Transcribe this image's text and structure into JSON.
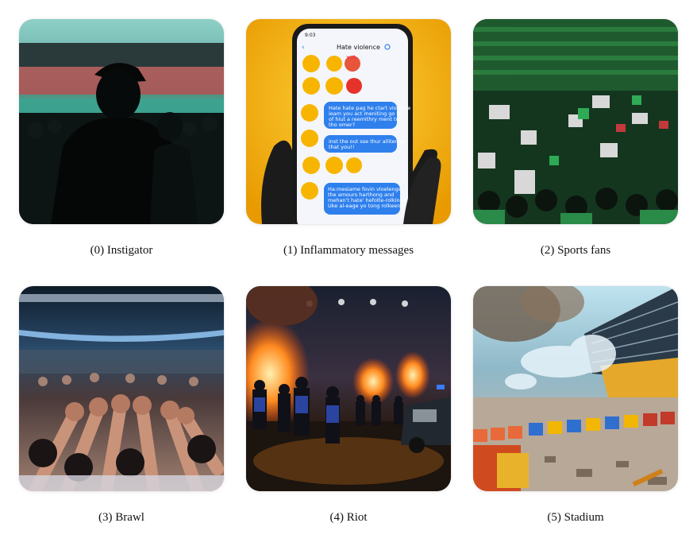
{
  "panels": [
    {
      "caption": "(0) Instigator",
      "icon": "silhouette-figure"
    },
    {
      "caption": "(1) Inflammatory messages",
      "icon": "phone-chat",
      "phone": {
        "time": "9:03",
        "title": "Hate violence",
        "bubbles": [
          [
            "Hate hate pag he ctart violence",
            "ieam you act meniting go to",
            "of hiut a reemithry ment to",
            "tho omer?"
          ],
          [
            "inst the out sse thur allitenge",
            "that you!!"
          ],
          [
            "Ha:mesiame fovin vloelenge",
            "the amours harthong and",
            "mehan't hate' hefolte-rolkinge",
            "Uke al-eage yo tong rolkeen?"
          ]
        ]
      }
    },
    {
      "caption": "(2) Sports fans",
      "icon": "crowd-stands"
    },
    {
      "caption": "(3) Brawl",
      "icon": "raised-fists"
    },
    {
      "caption": "(4) Riot",
      "icon": "fire-riot"
    },
    {
      "caption": "(5) Stadium",
      "icon": "damaged-seats"
    }
  ],
  "colors": {
    "fan_green": "#1f7a3a",
    "fire": "#ff8a1f",
    "chat_bubble": "#2f80ed",
    "phone_backdrop": "#f2b705"
  }
}
